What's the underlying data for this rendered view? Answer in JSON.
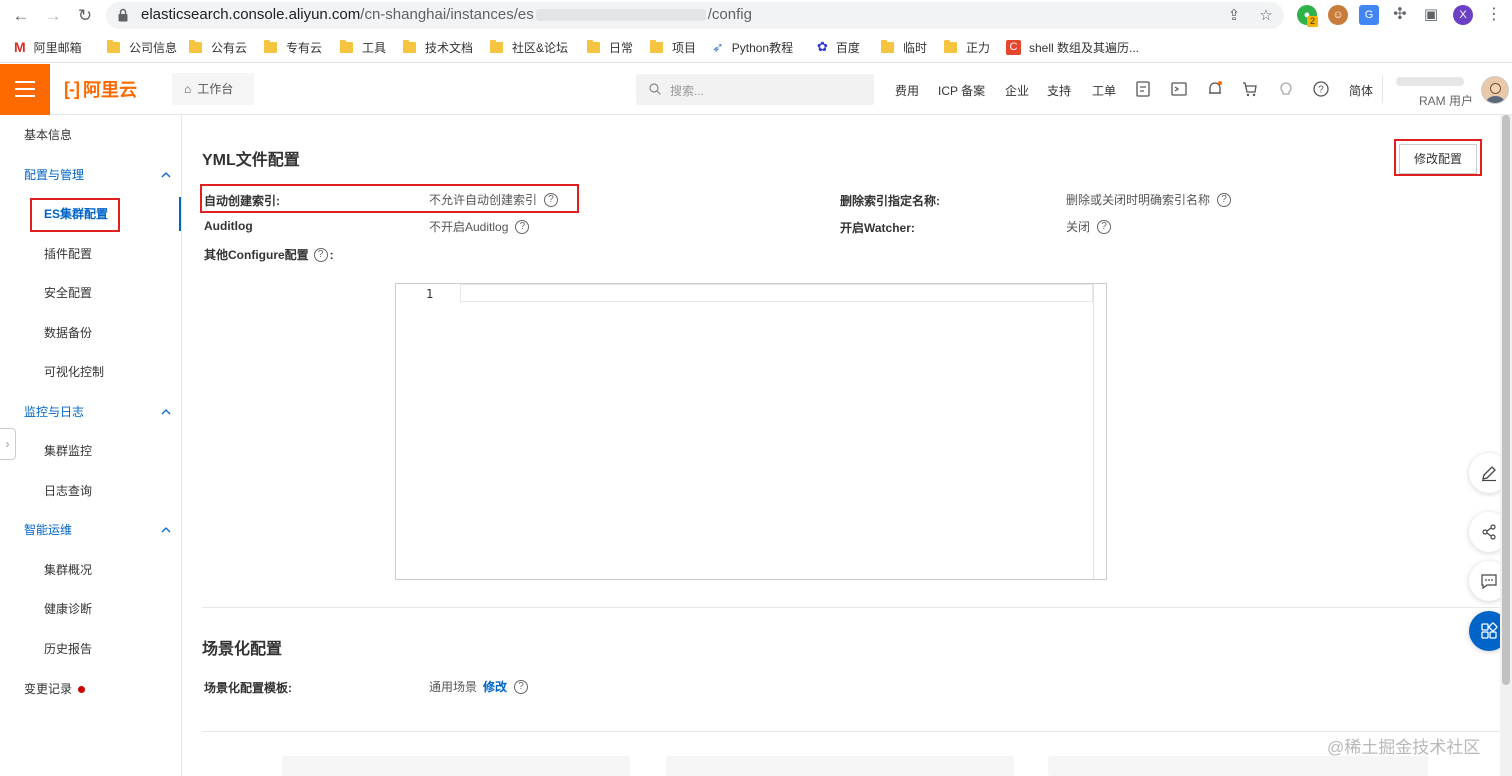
{
  "browser": {
    "url_host": "elasticsearch.console.aliyun.com",
    "url_path": "/cn-shanghai/instances/es",
    "url_tail": "/config",
    "extension_badge": "2",
    "profile_initial": "X",
    "bookmarks": [
      {
        "label": "阿里邮箱",
        "icon": "mail-icon"
      },
      {
        "label": "公司信息",
        "icon": "folder-icon"
      },
      {
        "label": "公有云",
        "icon": "folder-icon"
      },
      {
        "label": "专有云",
        "icon": "folder-icon"
      },
      {
        "label": "工具",
        "icon": "folder-icon"
      },
      {
        "label": "技术文档",
        "icon": "folder-icon"
      },
      {
        "label": "社区&论坛",
        "icon": "folder-icon"
      },
      {
        "label": "日常",
        "icon": "folder-icon"
      },
      {
        "label": "项目",
        "icon": "folder-icon"
      },
      {
        "label": "Python教程",
        "icon": "rocket-icon"
      },
      {
        "label": "百度",
        "icon": "baidu-paw-icon"
      },
      {
        "label": "临时",
        "icon": "folder-icon"
      },
      {
        "label": "正力",
        "icon": "folder-icon"
      },
      {
        "label": "shell 数组及其遍历...",
        "icon": "csdn-icon"
      }
    ]
  },
  "console": {
    "brand": "阿里云",
    "workbench": "工作台",
    "search_placeholder": "搜索...",
    "nav": [
      "费用",
      "ICP 备案",
      "企业",
      "支持",
      "工单"
    ],
    "lang": "简体",
    "user_role": "RAM 用户",
    "brand_color": "#ff6a00",
    "accent_color": "#0064c8"
  },
  "sidebar": {
    "basic_info": "基本信息",
    "groups": [
      {
        "label": "配置与管理",
        "items": [
          "ES集群配置",
          "插件配置",
          "安全配置",
          "数据备份",
          "可视化控制"
        ]
      },
      {
        "label": "监控与日志",
        "items": [
          "集群监控",
          "日志查询"
        ]
      },
      {
        "label": "智能运维",
        "items": [
          "集群概况",
          "健康诊断",
          "历史报告"
        ]
      }
    ],
    "change_log": "变更记录",
    "active_item": "ES集群配置"
  },
  "yml": {
    "title": "YML文件配置",
    "edit_button": "修改配置",
    "auto_index_label": "自动创建索引:",
    "auto_index_value": "不允许自动创建索引",
    "delete_index_label": "删除索引指定名称:",
    "delete_index_value": "删除或关闭时明确索引名称",
    "auditlog_label": "Auditlog",
    "auditlog_value": "不开启Auditlog",
    "watcher_label": "开启Watcher:",
    "watcher_value": "关闭",
    "other_config_label": "其他Configure配置",
    "editor_line_number": "1"
  },
  "scenario": {
    "title": "场景化配置",
    "template_label": "场景化配置模板:",
    "template_value": "通用场景",
    "modify_link": "修改"
  },
  "help_glyph": "?",
  "watermark": "@稀土掘金技术社区"
}
